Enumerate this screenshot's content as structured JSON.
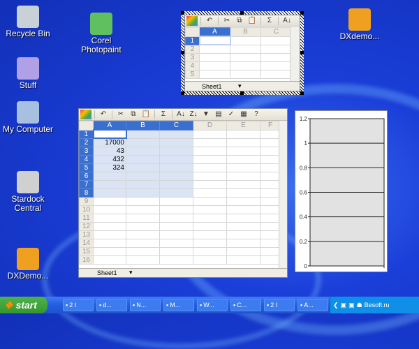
{
  "desktop": {
    "icons": [
      {
        "label": "Recycle Bin",
        "name": "recycle-bin",
        "color": "#c8d0d8"
      },
      {
        "label": "Stuff",
        "name": "stuff",
        "color": "#b0a0e8"
      },
      {
        "label": "My Computer",
        "name": "my-computer",
        "color": "#a8c0e0"
      },
      {
        "label": "Stardock Central",
        "name": "stardock-central",
        "color": "#d0d0d0"
      },
      {
        "label": "DXDemo...",
        "name": "dxdemo-1",
        "color": "#f0a020"
      },
      {
        "label": "Corel Photopaint",
        "name": "corel-photopaint",
        "color": "#60c060"
      },
      {
        "label": "DXdemo...",
        "name": "dxdemo-2",
        "color": "#f0a020"
      }
    ]
  },
  "toolbar": {
    "icons": [
      "office-logo",
      "undo",
      "cut",
      "copy",
      "paste",
      "autosum",
      "sort-ascending",
      "sort-descending",
      "filter",
      "export",
      "chart-wizard",
      "properties",
      "help"
    ],
    "glyphs": {
      "undo": "↶",
      "cut": "✂",
      "copy": "⧉",
      "paste": "📋",
      "autosum": "Σ",
      "sort-ascending": "A↓",
      "sort-descending": "Z↓",
      "filter": "▼",
      "export": "▤",
      "chart-wizard": "✓",
      "properties": "▦",
      "help": "?"
    }
  },
  "small_sheet": {
    "columns": [
      "A",
      "B",
      "C"
    ],
    "rows": [
      "1",
      "2",
      "3",
      "4",
      "5"
    ],
    "sheet_tab": "Sheet1"
  },
  "big_sheet": {
    "columns": [
      "A",
      "B",
      "C",
      "D",
      "E",
      "F"
    ],
    "rows": [
      "1",
      "2",
      "3",
      "4",
      "5",
      "6",
      "7",
      "8",
      "9",
      "10",
      "11",
      "12",
      "13",
      "14",
      "15",
      "16"
    ],
    "cells_A": [
      "",
      "17000",
      "43",
      "432",
      "324"
    ],
    "sheet_tab": "Sheet1"
  },
  "chart": {
    "y_ticks": [
      "1.2",
      "1",
      "0.8",
      "0.6",
      "0.4",
      "0.2",
      "0"
    ]
  },
  "taskbar": {
    "start_label": "start",
    "tasks": [
      {
        "label": "2 I",
        "icon": "ie-icon"
      },
      {
        "label": "d...",
        "icon": "diamond-icon"
      },
      {
        "label": "N...",
        "icon": "network-icon"
      },
      {
        "label": "M...",
        "icon": "excel-icon"
      },
      {
        "label": "W...",
        "icon": "paint-icon"
      },
      {
        "label": "C...",
        "icon": "camera-icon"
      },
      {
        "label": "2 I",
        "icon": "console-icon"
      },
      {
        "label": "A...",
        "icon": "agent-icon"
      }
    ],
    "tray_text": "Besoft.ru"
  }
}
